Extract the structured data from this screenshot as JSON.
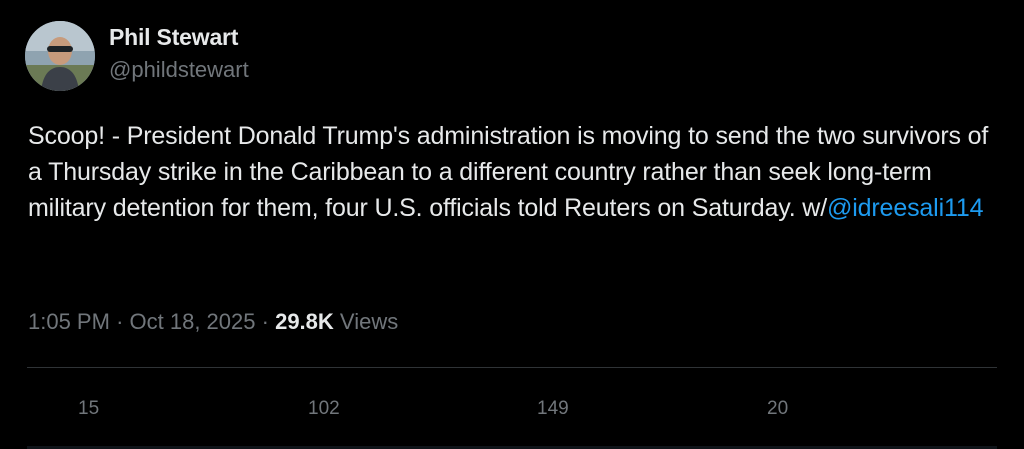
{
  "author": {
    "display_name": "Phil Stewart",
    "handle": "@phildstewart"
  },
  "tweet": {
    "text": "Scoop! - President Donald Trump's administration is moving to send the two survivors of a Thursday strike in the Caribbean to a different country rather than seek long-term military detention for them, four U.S. officials told Reuters on Saturday. w/",
    "mention": "@idreesali114"
  },
  "meta": {
    "time": "1:05 PM",
    "separator": "·",
    "date": "Oct 18, 2025",
    "views_count": "29.8K",
    "views_label": "Views"
  },
  "actions": {
    "replies": "15",
    "reposts": "102",
    "likes": "149",
    "bookmarks": "20"
  },
  "colors": {
    "background": "#000000",
    "text": "#e7e9ea",
    "secondary": "#71767b",
    "link": "#1d9bf0",
    "divider": "#2f3336"
  }
}
